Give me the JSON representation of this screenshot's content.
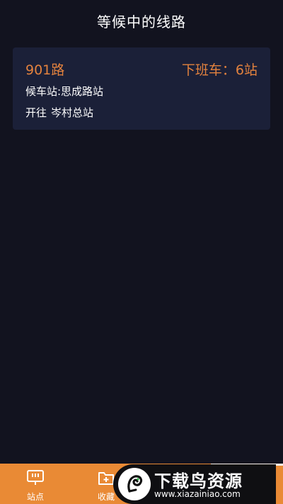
{
  "header": {
    "title": "等候中的线路"
  },
  "route_card": {
    "route_name": "901路",
    "next_bus": "下班车：6站",
    "stop": "候车站:思成路站",
    "dest_prefix": "开往",
    "dest_name": "岑村总站"
  },
  "tabbar": {
    "tab_stops_label": "站点",
    "tab_favorites_label": "收藏",
    "stops_icon": "bus-stop-sign-icon",
    "favorites_icon": "folder-plus-icon"
  },
  "watermark": {
    "title": "下载鸟资源",
    "url": "www.xiazainiao.com",
    "logo_icon": "bird-logo-icon"
  },
  "colors": {
    "background": "#12131f",
    "card": "#1b2038",
    "accent": "#e3823e",
    "tabbar": "#e98a35"
  }
}
